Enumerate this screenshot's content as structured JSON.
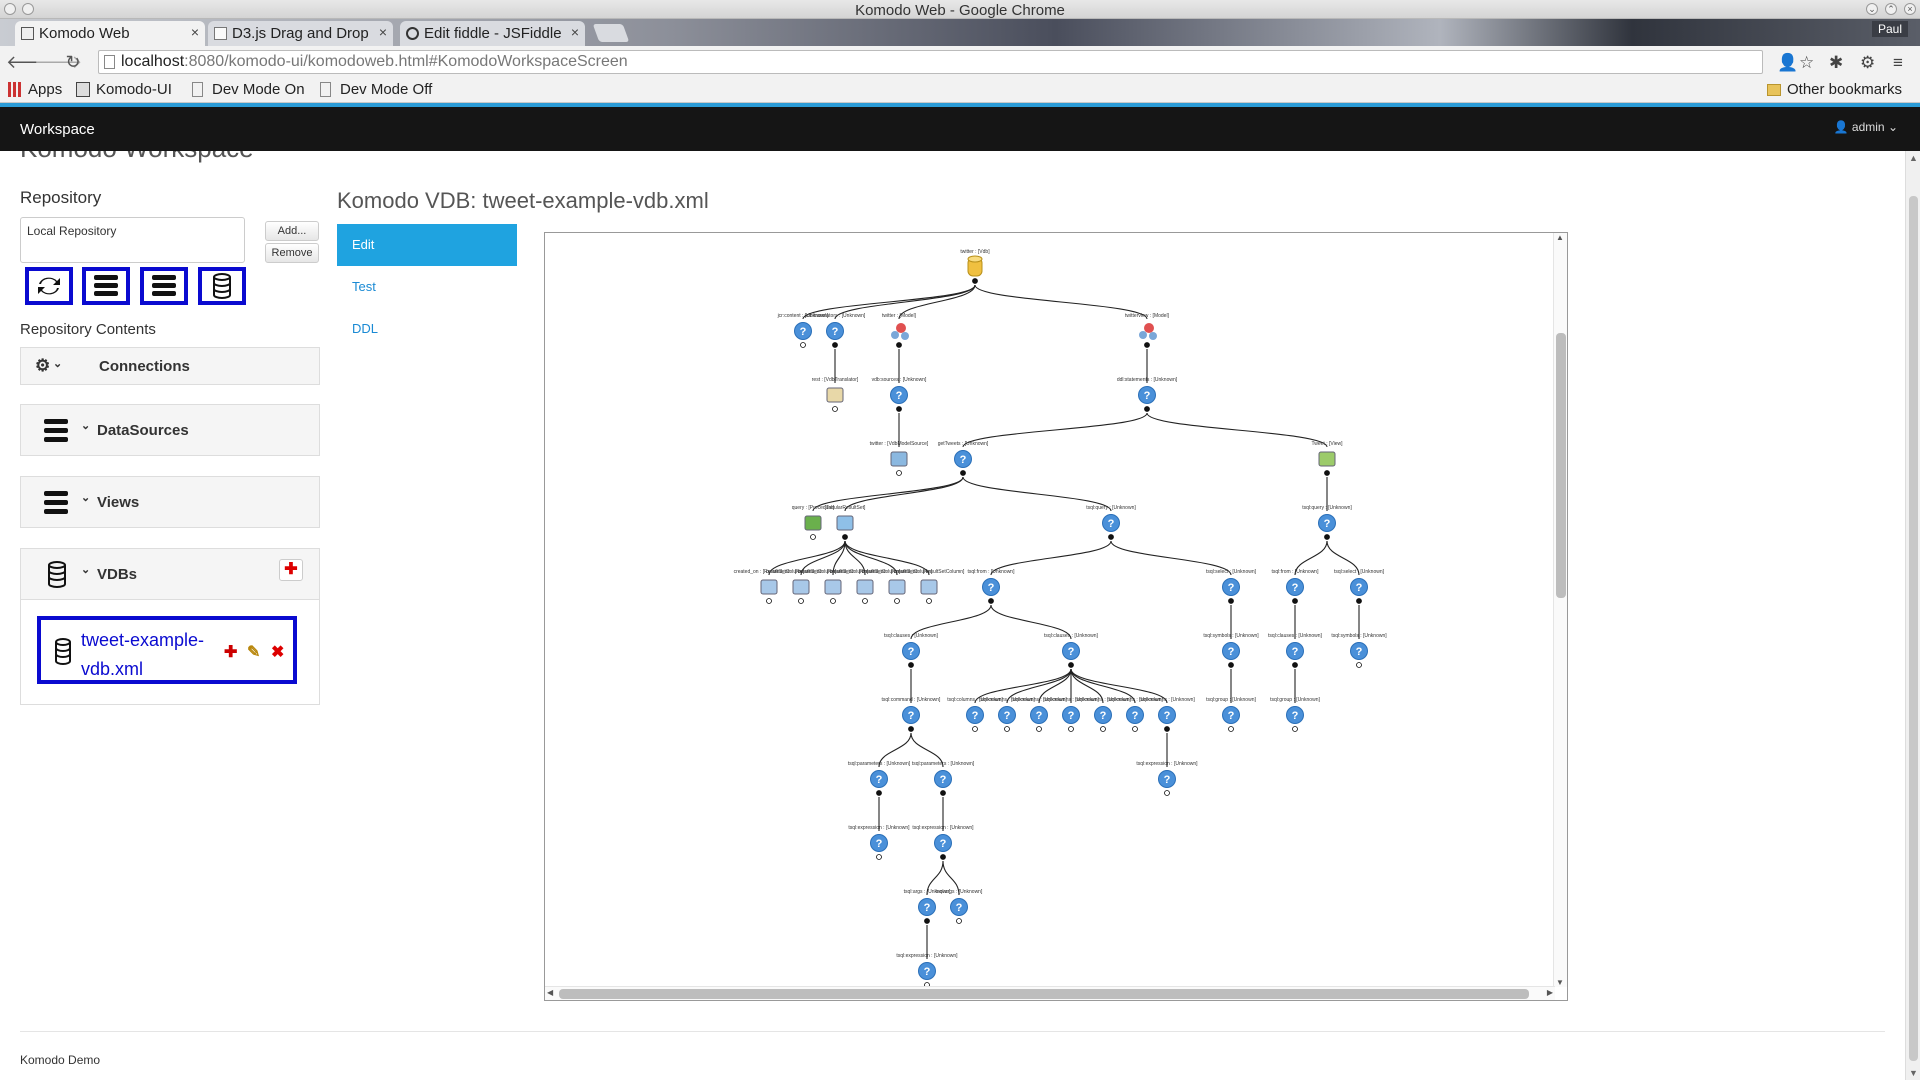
{
  "window": {
    "title": "Komodo Web - Google Chrome",
    "profile": "Paul"
  },
  "browser": {
    "tabs": [
      {
        "label": "Komodo Web",
        "active": true
      },
      {
        "label": "D3.js Drag and Drop",
        "active": false
      },
      {
        "label": "Edit fiddle - JSFiddle",
        "active": false
      }
    ],
    "url_host": "localhost",
    "url_rest": ":8080/komodo-ui/komodoweb.html#KomodoWorkspaceScreen",
    "bookmarks": [
      "Apps",
      "Komodo-UI",
      "Dev Mode On",
      "Dev Mode Off"
    ],
    "other_bookmarks": "Other bookmarks"
  },
  "app": {
    "brand": "Workspace",
    "user": "admin",
    "page_title": "Komodo Workspace"
  },
  "repository": {
    "label": "Repository",
    "selected": "Local Repository",
    "add_label": "Add...",
    "remove_label": "Remove",
    "contents_label": "Repository Contents"
  },
  "sections": {
    "connections": "Connections",
    "datasources": "DataSources",
    "views": "Views",
    "vdbs": "VDBs"
  },
  "vdb_item": "tweet-example-vdb.xml",
  "editor": {
    "heading": "Komodo VDB: tweet-example-vdb.xml",
    "tabs": [
      "Edit",
      "Test",
      "DDL"
    ],
    "active_tab": "Edit"
  },
  "footer": "Komodo Demo",
  "colors": {
    "accent": "#1fa3e0",
    "highlight_border": "#0a0ad0",
    "nav_bg": "#151515"
  },
  "diagram": {
    "nodes": [
      {
        "label": "twitter : [Vdb]",
        "icon": "database-icon"
      },
      {
        "label": "jcr:content : [Unknown]",
        "icon": "question-icon"
      },
      {
        "label": "vdb:translators : [Unknown]",
        "icon": "question-icon"
      },
      {
        "label": "twitter : [Model]",
        "icon": "model-icon"
      },
      {
        "label": "twitterview : [Model]",
        "icon": "model-icon"
      },
      {
        "label": "rest : [VdbTranslator]",
        "icon": "book-icon"
      },
      {
        "label": "vdb:sources : [Unknown]",
        "icon": "question-icon"
      },
      {
        "label": "ddl:statements : [Unknown]",
        "icon": "question-icon"
      },
      {
        "label": "twitter : [VdbModelSource]",
        "icon": "source-icon"
      },
      {
        "label": "getTweets : [Unknown]",
        "icon": "question-icon"
      },
      {
        "label": "Tweet : [View]",
        "icon": "view-icon"
      },
      {
        "label": "query : [Procedure]",
        "icon": "procedure-icon"
      },
      {
        "label": "[TabularResultSet]",
        "icon": "resultset-icon"
      },
      {
        "label": "tsql:query : [Unknown]",
        "icon": "question-icon"
      },
      {
        "label": "created_on : [ResultSetColumn]",
        "icon": "column-icon"
      },
      {
        "label": "tsql:from : [Unknown]",
        "icon": "question-icon"
      },
      {
        "label": "tsql:select : [Unknown]",
        "icon": "question-icon"
      },
      {
        "label": "tsql:clauses : [Unknown]",
        "icon": "question-icon"
      },
      {
        "label": "tsql:symbols : [Unknown]",
        "icon": "question-icon"
      },
      {
        "label": "tsql:command : [Unknown]",
        "icon": "question-icon"
      },
      {
        "label": "tsql:columns : [Unknown]",
        "icon": "question-icon"
      },
      {
        "label": "tsql:group : [Unknown]",
        "icon": "question-icon"
      },
      {
        "label": "tsql:parameters : [Unknown]",
        "icon": "question-icon"
      },
      {
        "label": "tsql:expression : [Unknown]",
        "icon": "question-icon"
      },
      {
        "label": "tsql:args : [Unknown]",
        "icon": "question-icon"
      }
    ]
  }
}
